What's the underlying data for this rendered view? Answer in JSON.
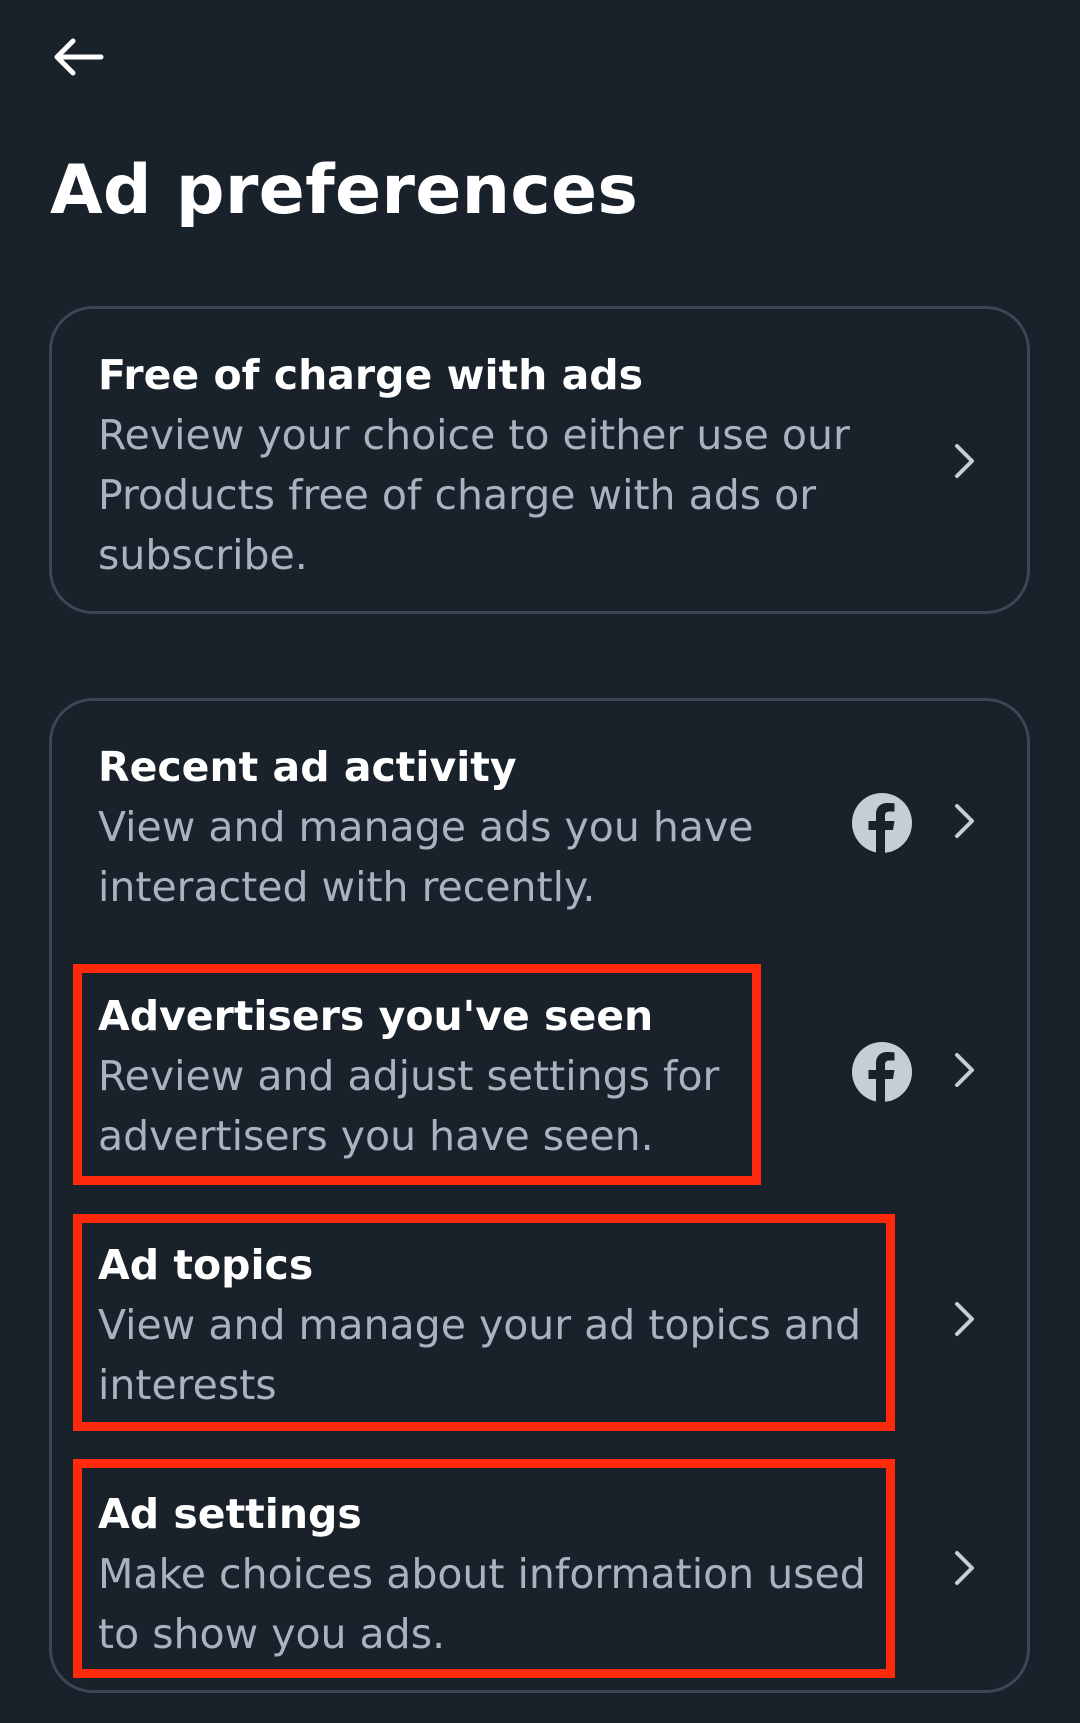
{
  "header": {
    "back_icon": "arrow-left-icon",
    "title": "Ad preferences"
  },
  "cards": [
    {
      "rows": [
        {
          "title": "Free of charge with ads",
          "description": "Review your choice to either use our Products free of charge with ads or subscribe.",
          "icon": "chevron-right-icon"
        }
      ]
    },
    {
      "rows": [
        {
          "title": "Recent ad activity",
          "description": "View and manage ads you have interacted with recently.",
          "icons": [
            "facebook-icon",
            "chevron-right-icon"
          ]
        },
        {
          "title": "Advertisers you've seen",
          "description": "Review and adjust settings for advertisers you have seen.",
          "icons": [
            "facebook-icon",
            "chevron-right-icon"
          ]
        },
        {
          "title": "Ad topics",
          "description": "View and manage your ad topics and interests",
          "icon": "chevron-right-icon"
        },
        {
          "title": "Ad settings",
          "description": "Make choices about information used to show you ads.",
          "icon": "chevron-right-icon"
        }
      ]
    }
  ],
  "colors": {
    "background": "#19212a",
    "card_border": "#3a4754",
    "description_text": "#a7b3be",
    "highlight_border": "#ff2a0c",
    "icon": "#c5ced6"
  }
}
